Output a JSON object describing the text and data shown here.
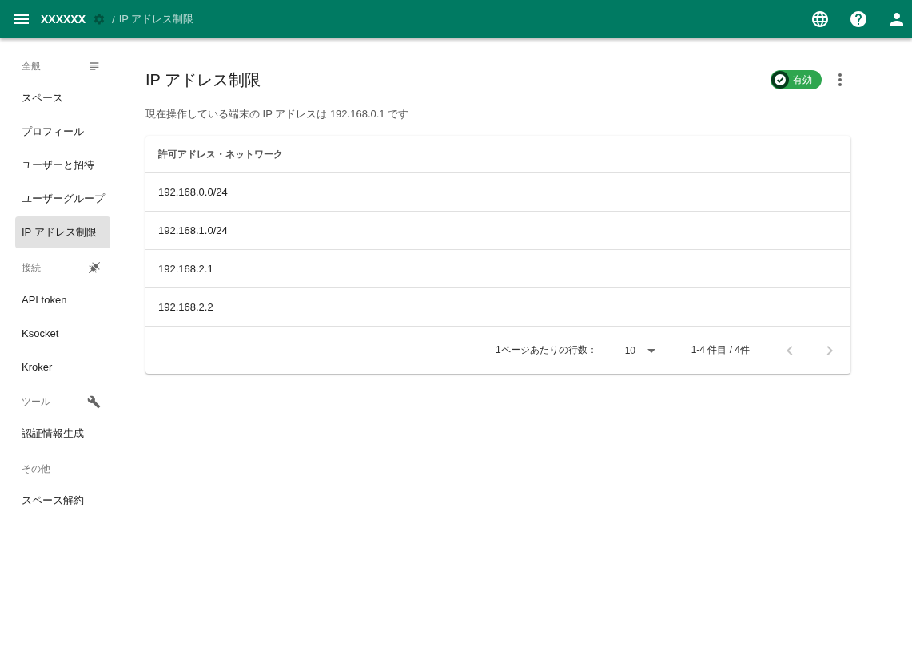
{
  "app_bar": {
    "title": "XXXXXX",
    "breadcrumb_separator": "/",
    "breadcrumb": "IP アドレス制限"
  },
  "sidebar": {
    "sections": [
      {
        "heading": "全般",
        "kind": "list",
        "items": [
          {
            "label": "スペース",
            "selected": false
          },
          {
            "label": "プロフィール",
            "selected": false
          },
          {
            "label": "ユーザーと招待",
            "selected": false
          },
          {
            "label": "ユーザーグループ",
            "selected": false
          },
          {
            "label": "IP アドレス制限",
            "selected": true
          }
        ]
      },
      {
        "heading": "接続",
        "kind": "plug",
        "items": [
          {
            "label": "API token",
            "selected": false
          },
          {
            "label": "Ksocket",
            "selected": false
          },
          {
            "label": "Kroker",
            "selected": false
          }
        ]
      },
      {
        "heading": "ツール",
        "kind": "wrench",
        "items": [
          {
            "label": "認証情報生成",
            "selected": false
          }
        ]
      },
      {
        "heading": "その他",
        "kind": "plain",
        "items": [
          {
            "label": "スペース解約",
            "selected": false
          }
        ]
      }
    ]
  },
  "page": {
    "title": "IP アドレス制限",
    "status": {
      "label": "有効",
      "on": true
    },
    "description": "現在操作している端末の IP アドレスは 192.168.0.1 です"
  },
  "table": {
    "columns": [
      "許可アドレス・ネットワーク"
    ],
    "rows": [
      [
        "192.168.0.0/24"
      ],
      [
        "192.168.1.0/24"
      ],
      [
        "192.168.2.1"
      ],
      [
        "192.168.2.2"
      ]
    ]
  },
  "pagination": {
    "rows_per_page_label": "1ページあたりの行数：",
    "rows_per_page": "10",
    "range": "1-4 件目 / 4件",
    "previous": {
      "disabled": true
    },
    "next": {
      "disabled": true
    }
  }
}
